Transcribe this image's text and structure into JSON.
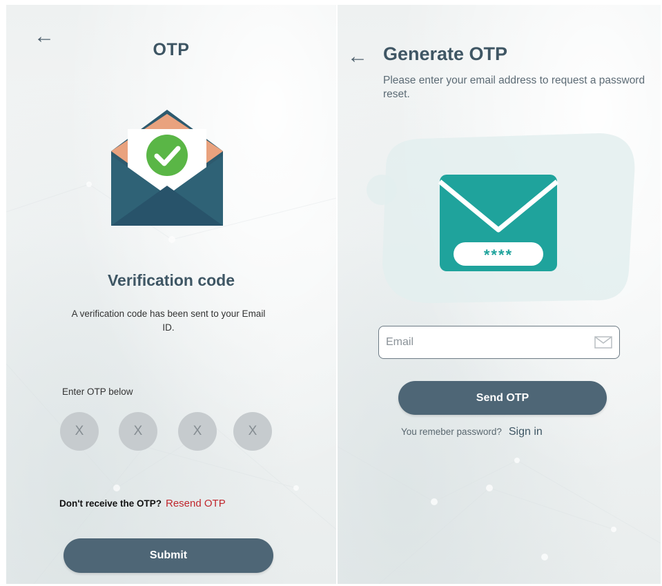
{
  "otp_screen": {
    "title": "OTP",
    "heading": "Verification code",
    "description": "A verification code has been sent to your Email ID.",
    "otp_label": "Enter OTP below",
    "otp_digits": [
      "X",
      "X",
      "X",
      "X"
    ],
    "resend_prompt": "Don't receive the OTP?",
    "resend_link": "Resend OTP",
    "submit_label": "Submit"
  },
  "generate_screen": {
    "title": "Generate OTP",
    "description": "Please enter your email address to request a password reset.",
    "email_placeholder": "Email",
    "send_label": "Send OTP",
    "signin_prompt": "You remeber password?",
    "signin_link": "Sign in",
    "masked_code": "****"
  },
  "icons": {
    "back": "←",
    "envelope_check": "envelope-check-icon",
    "mail_password": "mail-password-icon",
    "mail_field": "mail-field-icon"
  },
  "colors": {
    "primary": "#4e6676",
    "heading": "#3e5664",
    "link_red": "#c0262c",
    "envelope_dark": "#2d5a6e",
    "envelope_flap": "#e9a27e",
    "check_green": "#5ab646",
    "mail_teal": "#1fa39c"
  }
}
